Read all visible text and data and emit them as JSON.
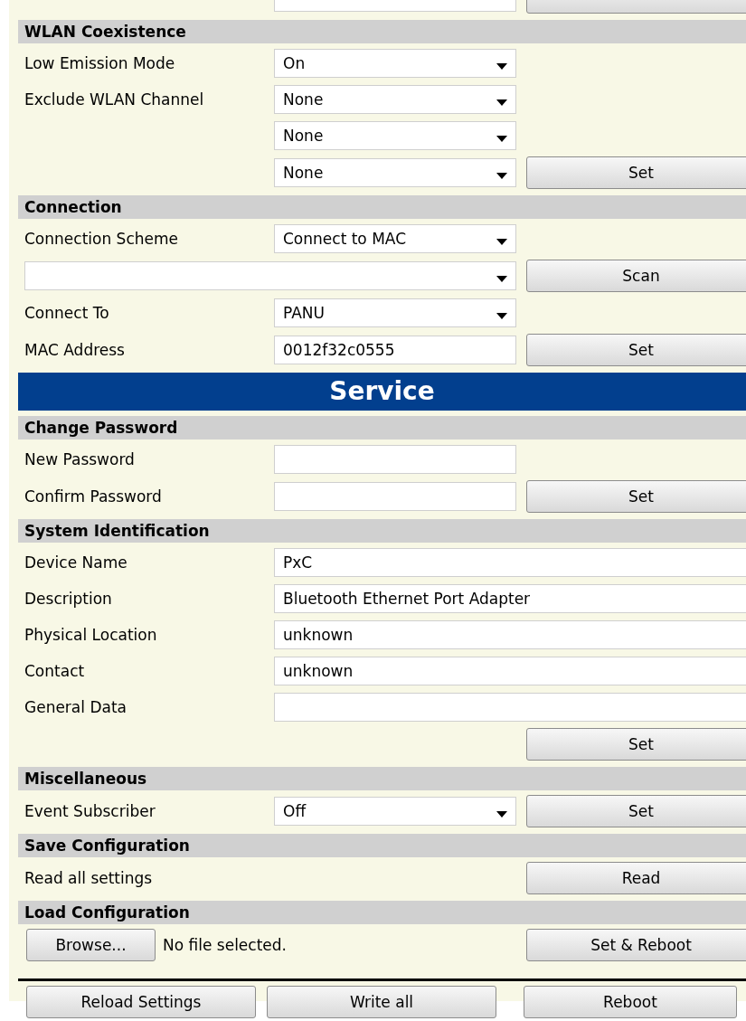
{
  "rows": [
    {
      "kind": "row",
      "field": {
        "kind": "input"
      },
      "button": {}
    },
    {
      "kind": "header",
      "title": "WLAN Coexistence"
    },
    {
      "kind": "row",
      "label": "Low Emission Mode",
      "field": {
        "kind": "select",
        "value": "On"
      }
    },
    {
      "kind": "row",
      "label": "Exclude WLAN Channel",
      "field": {
        "kind": "select",
        "value": "None"
      }
    },
    {
      "kind": "row",
      "field": {
        "kind": "select",
        "value": "None"
      }
    },
    {
      "kind": "row",
      "field": {
        "kind": "select",
        "value": "None"
      },
      "button": {
        "label": "Set"
      }
    },
    {
      "kind": "header",
      "title": "Connection"
    },
    {
      "kind": "row",
      "label": "Connection Scheme",
      "field": {
        "kind": "select",
        "value": "Connect to MAC"
      }
    },
    {
      "kind": "row",
      "field": {
        "kind": "full-select"
      },
      "button": {
        "label": "Scan"
      }
    },
    {
      "kind": "row",
      "label": "Connect To",
      "field": {
        "kind": "select",
        "value": "PANU"
      }
    },
    {
      "kind": "row",
      "label": "MAC Address",
      "field": {
        "kind": "input",
        "value": "0012f32c0555"
      },
      "button": {
        "label": "Set"
      }
    },
    {
      "kind": "banner",
      "title": "Service"
    },
    {
      "kind": "header",
      "title": "Change Password"
    },
    {
      "kind": "row",
      "label": "New Password",
      "field": {
        "kind": "input"
      }
    },
    {
      "kind": "row",
      "label": "Confirm Password",
      "field": {
        "kind": "input"
      },
      "button": {
        "label": "Set"
      }
    },
    {
      "kind": "header",
      "title": "System Identification"
    },
    {
      "kind": "row",
      "label": "Device Name",
      "field": {
        "kind": "wide-input",
        "value": "PxC"
      }
    },
    {
      "kind": "row",
      "label": "Description",
      "field": {
        "kind": "wide-input",
        "value": "Bluetooth Ethernet Port Adapter"
      }
    },
    {
      "kind": "row",
      "label": "Physical Location",
      "field": {
        "kind": "wide-input",
        "value": "unknown"
      }
    },
    {
      "kind": "row",
      "label": "Contact",
      "field": {
        "kind": "wide-input",
        "value": "unknown"
      }
    },
    {
      "kind": "row",
      "label": "General Data",
      "field": {
        "kind": "wide-input"
      }
    },
    {
      "kind": "row",
      "button": {
        "label": "Set"
      }
    },
    {
      "kind": "header",
      "title": "Miscellaneous"
    },
    {
      "kind": "row",
      "label": "Event Subscriber",
      "field": {
        "kind": "select",
        "value": "Off"
      },
      "button": {
        "label": "Set"
      }
    },
    {
      "kind": "header",
      "title": "Save Configuration"
    },
    {
      "kind": "row",
      "label": "Read all settings",
      "button": {
        "label": "Read"
      }
    },
    {
      "kind": "header",
      "title": "Load Configuration"
    },
    {
      "kind": "file",
      "browse": "Browse...",
      "status": "No file selected.",
      "button": {
        "label": "Set & Reboot"
      }
    },
    {
      "kind": "footer",
      "buttons": [
        "Reload Settings",
        "Write all",
        "Reboot"
      ]
    }
  ]
}
